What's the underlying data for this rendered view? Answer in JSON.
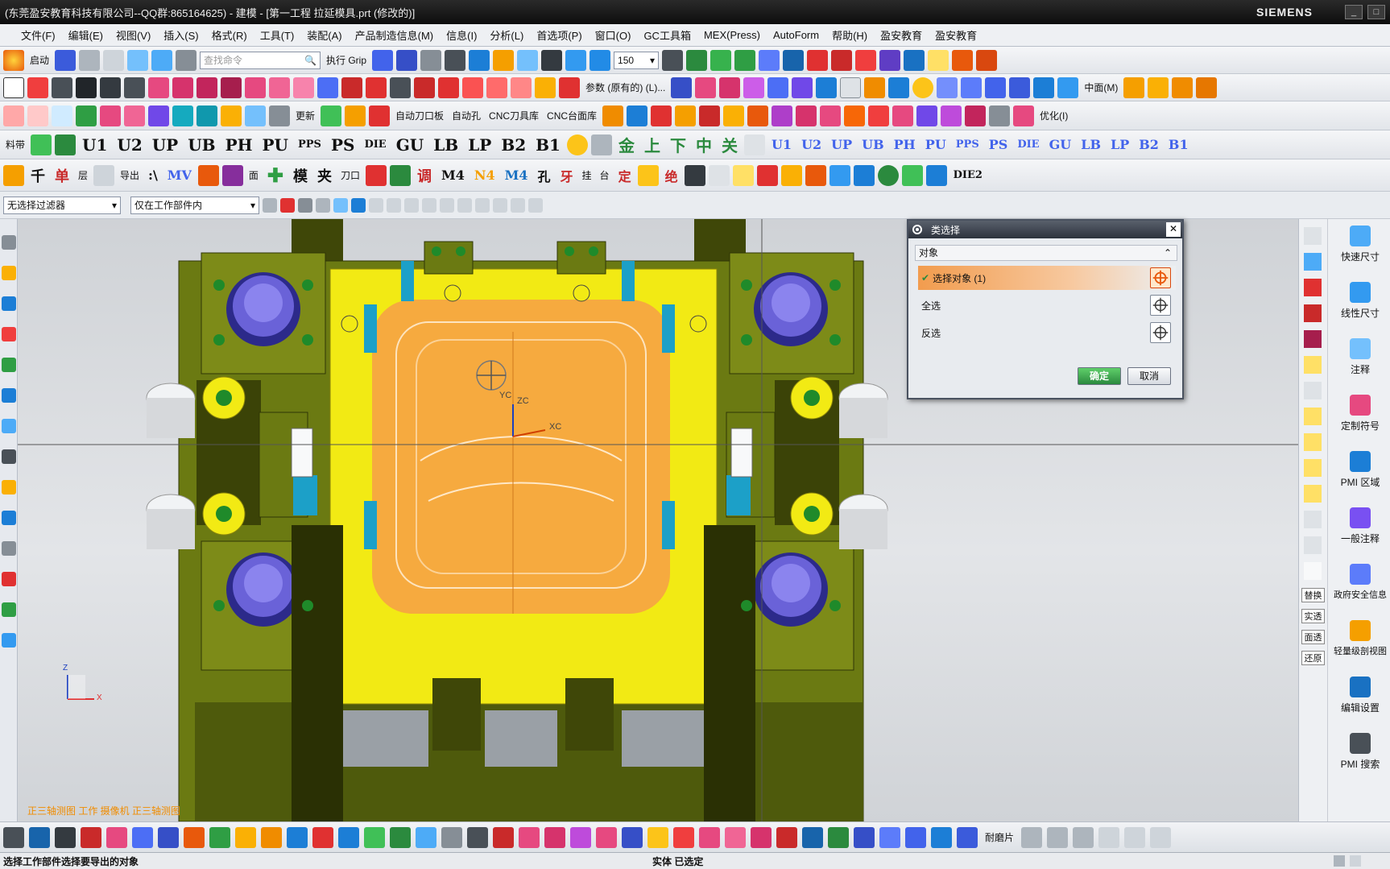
{
  "titlebar": {
    "title": "(东莞盈安教育科技有限公司--QQ群:865164625) - 建模 - [第一工程 拉延模具.prt (修改的)]",
    "brand": "SIEMENS"
  },
  "menubar": [
    "文件(F)",
    "编辑(E)",
    "视图(V)",
    "插入(S)",
    "格式(R)",
    "工具(T)",
    "装配(A)",
    "产品制造信息(M)",
    "信息(I)",
    "分析(L)",
    "首选项(P)",
    "窗口(O)",
    "GC工具箱",
    "MEX(Press)",
    "AutoForm",
    "帮助(H)",
    "盈安教育",
    "盈安教育"
  ],
  "toolbar1": {
    "start_label": "启动",
    "search_placeholder": "查找命令",
    "grip_label": "执行 Grip",
    "zoom_value": "150"
  },
  "toolbar2": {
    "param_label": "参数 (原有的) (L)...",
    "layer_label": "中面(M)"
  },
  "toolbar3": {
    "labels": [
      "更新",
      "自动刀口板",
      "自动孔",
      "CNC刀具库",
      "CNC台面库",
      "优化(I)"
    ]
  },
  "toolbar4": {
    "left_labels": [
      "料带",
      "U1",
      "U2",
      "UP",
      "UB",
      "PH",
      "PU",
      "PPS",
      "PS",
      "DIE",
      "GU",
      "LB",
      "LP",
      "B2",
      "B1"
    ],
    "right_labels": [
      "U1",
      "U2",
      "UP",
      "UB",
      "PH",
      "PU",
      "PPS",
      "PS",
      "DIE",
      "GU",
      "LB",
      "LP",
      "B2",
      "B1"
    ],
    "chars": [
      "金",
      "上",
      "下",
      "中",
      "关"
    ]
  },
  "toolbar5": {
    "labels": [
      "千",
      "单",
      "层",
      "导出",
      ":\\",
      "MV",
      "面",
      "模",
      "夹",
      "刀口",
      "调",
      "M4",
      "N4",
      "M4",
      "孔",
      "牙",
      "挂",
      "台",
      "定",
      "绝",
      "DIE2"
    ]
  },
  "filterbar": {
    "type_filter": "无选择过滤器",
    "scope_filter": "仅在工作部件内"
  },
  "dialog": {
    "title": "类选择",
    "group_label": "对象",
    "select_objects": "选择对象 (1)",
    "select_all": "全选",
    "invert": "反选",
    "ok": "确定",
    "cancel": "取消"
  },
  "rightbar": {
    "items": [
      "快速尺寸",
      "线性尺寸",
      "注释",
      "定制符号",
      "PMI 区域",
      "一般注释",
      "政府安全信息",
      "轻量级剖视图",
      "编辑设置",
      "PMI 搜索"
    ],
    "narrow_labels": [
      "替换",
      "实透",
      "面透",
      "还原"
    ]
  },
  "viewport": {
    "axis_labels": {
      "yc": "YC",
      "zc": "ZC",
      "xc": "XC"
    },
    "triad_labels": {
      "z": "Z",
      "x": "X"
    },
    "view_note": "正三轴测图 工作 摄像机 正三轴测图"
  },
  "bottomtb": {
    "label": "耐磨片"
  },
  "statusbar": {
    "prompt": "选择工作部件选择要导出的对象",
    "status": "实体 已选定"
  },
  "colors": {
    "mold_base": "#6b7a12",
    "plate_yellow": "#f2ea14",
    "part_orange": "#f6a443",
    "accent_green": "#1f8a2a",
    "bushing_blue": "#6a62d8",
    "dialog_highlight": "#f29c4e"
  }
}
